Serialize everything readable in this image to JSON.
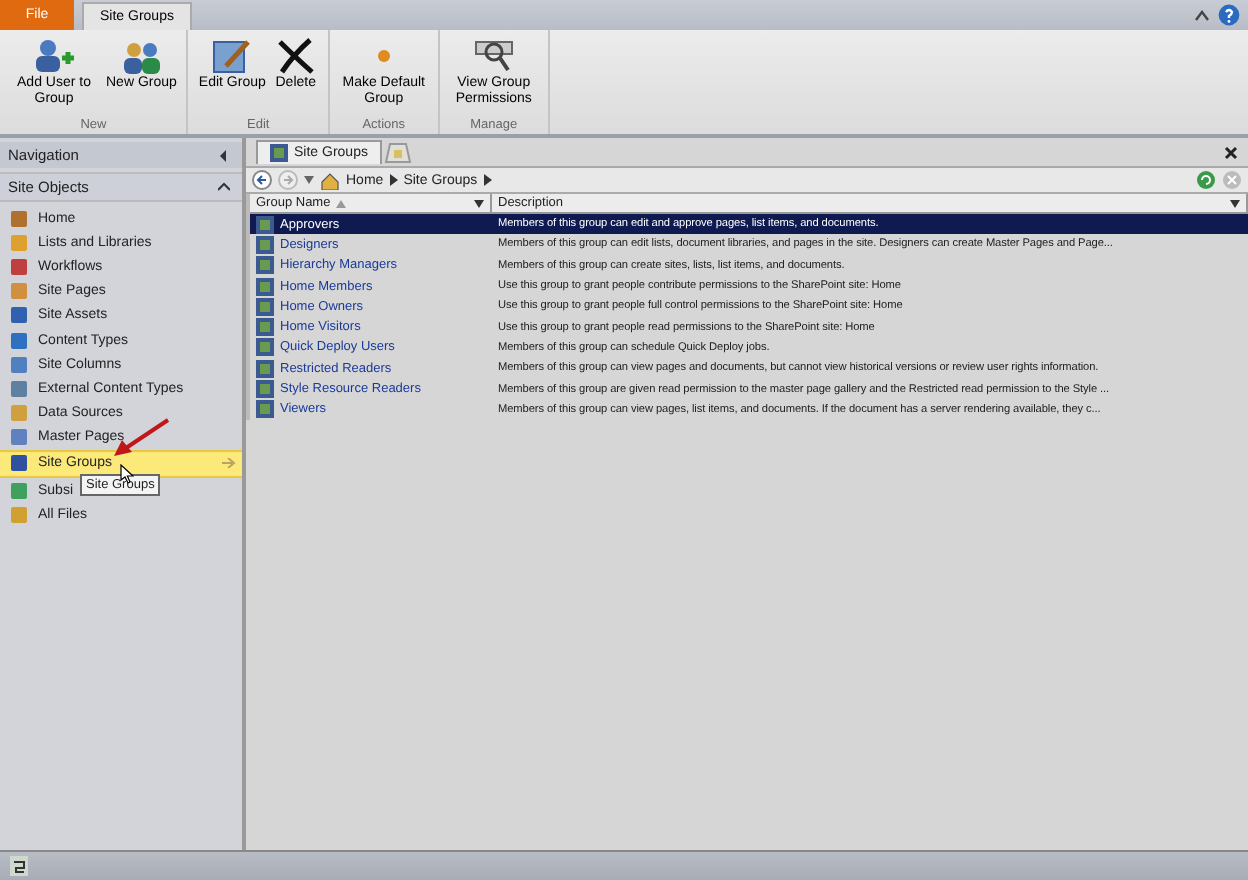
{
  "ribbon": {
    "file_tab": "File",
    "tabs": [
      {
        "label": "Site Groups",
        "selected": true
      }
    ],
    "groups": [
      {
        "label": "New",
        "buttons": [
          {
            "label": "Add User to Group",
            "kind": "adduser"
          },
          {
            "label": "New Group",
            "kind": "newgroup"
          }
        ]
      },
      {
        "label": "Edit",
        "buttons": [
          {
            "label": "Edit Group",
            "kind": "edit"
          },
          {
            "label": "Delete",
            "kind": "delete"
          }
        ]
      },
      {
        "label": "Actions",
        "buttons": [
          {
            "label": "Make Default Group",
            "kind": "dot"
          }
        ]
      },
      {
        "label": "Manage",
        "buttons": [
          {
            "label": "View Group Permissions",
            "kind": "perm"
          }
        ]
      }
    ]
  },
  "navigation": {
    "title": "Navigation",
    "section": "Site Objects",
    "items": [
      {
        "label": "Home",
        "selected": false
      },
      {
        "label": "Lists and Libraries",
        "selected": false
      },
      {
        "label": "Workflows",
        "selected": false
      },
      {
        "label": "Site Pages",
        "selected": false
      },
      {
        "label": "Site Assets",
        "selected": false
      },
      {
        "label": "Content Types",
        "selected": false
      },
      {
        "label": "Site Columns",
        "selected": false
      },
      {
        "label": "External Content Types",
        "selected": false
      },
      {
        "label": "Data Sources",
        "selected": false
      },
      {
        "label": "Master Pages",
        "selected": false
      },
      {
        "label": "Site Groups",
        "selected": true
      },
      {
        "label": "Subsi",
        "selected": false
      },
      {
        "label": "All Files",
        "selected": false
      }
    ],
    "tooltip": "Site Groups"
  },
  "document_tab": {
    "label": "Site Groups"
  },
  "breadcrumb": [
    "Home",
    "Site Groups"
  ],
  "table": {
    "columns": [
      "Group Name",
      "Description"
    ],
    "rows": [
      {
        "name": "Approvers",
        "description": "Members of this group can edit and approve pages, list items, and documents.",
        "selected": true
      },
      {
        "name": "Designers",
        "description": "Members of this group can edit lists, document libraries, and pages in the site. Designers can create Master Pages and Page...",
        "selected": false
      },
      {
        "name": "Hierarchy Managers",
        "description": "Members of this group can create sites, lists, list items, and documents.",
        "selected": false
      },
      {
        "name": "Home Members",
        "description": "Use this group to grant people contribute permissions to the SharePoint site: Home",
        "selected": false
      },
      {
        "name": "Home Owners",
        "description": "Use this group to grant people full control permissions to the SharePoint site: Home",
        "selected": false
      },
      {
        "name": "Home Visitors",
        "description": "Use this group to grant people read permissions to the SharePoint site: Home",
        "selected": false
      },
      {
        "name": "Quick Deploy Users",
        "description": "Members of this group can schedule Quick Deploy jobs.",
        "selected": false
      },
      {
        "name": "Restricted Readers",
        "description": "Members of this group can view pages and documents, but cannot view historical versions or review user rights information.",
        "selected": false
      },
      {
        "name": "Style Resource Readers",
        "description": "Members of this group are given read permission to the master page gallery and the Restricted read permission to the Style ...",
        "selected": false
      },
      {
        "name": "Viewers",
        "description": "Members of this group can view pages, list items, and documents.  If the document has a server rendering available, they c...",
        "selected": false
      }
    ]
  }
}
